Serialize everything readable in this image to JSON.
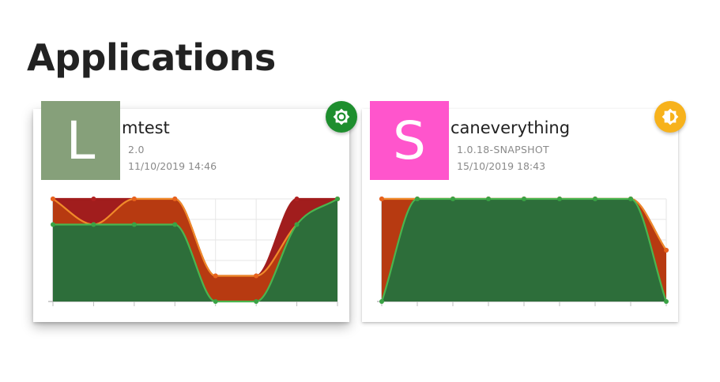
{
  "page": {
    "title": "Applications"
  },
  "apps": [
    {
      "initial": "L",
      "name": "mtest",
      "version": "2.0",
      "date": "11/10/2019 14:46",
      "avatar_color": "#86a07a",
      "status_color": "#1e8e2e",
      "status_icon": "brightness-auto-icon",
      "chart_data": {
        "type": "area",
        "x": [
          0,
          1,
          2,
          3,
          4,
          5,
          6,
          7
        ],
        "ylim": [
          0,
          100
        ],
        "grid": true,
        "series": [
          {
            "color": "#a11d1d",
            "values": [
              100,
              100,
              100,
              100,
              25,
              25,
              100,
              100
            ]
          },
          {
            "color": "#e8631c",
            "values": [
              100,
              75,
              100,
              100,
              25,
              25,
              75,
              100
            ]
          },
          {
            "color": "#3aa345",
            "values": [
              75,
              75,
              75,
              75,
              0,
              0,
              75,
              100
            ]
          }
        ]
      }
    },
    {
      "initial": "S",
      "name": "caneverything",
      "version": "1.0.18-SNAPSHOT",
      "date": "15/10/2019 18:43",
      "avatar_color": "#ff55cc",
      "status_color": "#f7b21c",
      "status_icon": "brightness-half-icon",
      "chart_data": {
        "type": "area",
        "x": [
          0,
          1,
          2,
          3,
          4,
          5,
          6,
          7,
          8
        ],
        "ylim": [
          0,
          100
        ],
        "grid": true,
        "series": [
          {
            "color": "#a11d1d",
            "values": [
              100,
              100,
              100,
              100,
              100,
              100,
              100,
              100,
              50
            ]
          },
          {
            "color": "#e8631c",
            "values": [
              100,
              100,
              100,
              100,
              100,
              100,
              100,
              100,
              50
            ]
          },
          {
            "color": "#3aa345",
            "values": [
              0,
              100,
              100,
              100,
              100,
              100,
              100,
              100,
              0
            ]
          }
        ]
      }
    }
  ]
}
